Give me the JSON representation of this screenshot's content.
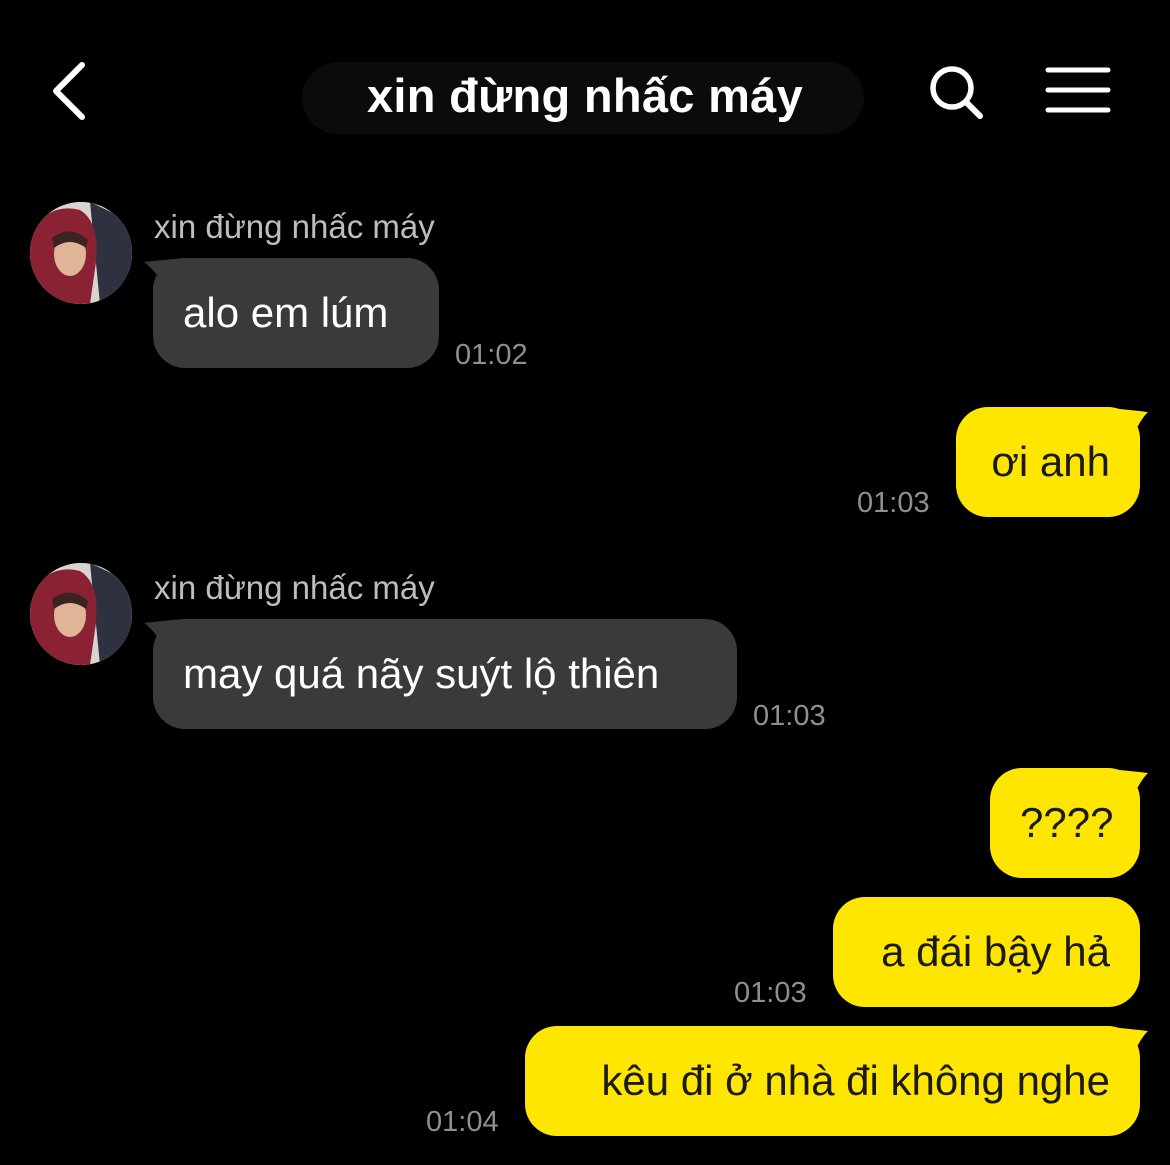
{
  "header": {
    "title": "xin đừng nhấc máy",
    "back_icon": "chevron-left-icon",
    "search_icon": "search-icon",
    "menu_icon": "hamburger-menu-icon"
  },
  "colors": {
    "background": "#000000",
    "incoming_bubble": "#3a3a3c",
    "outgoing_bubble": "#ffe600",
    "timestamp": "#8e8e93"
  },
  "messages": [
    {
      "direction": "incoming",
      "sender": "xin đừng nhấc máy",
      "text": "alo em lúm",
      "time": "01:02"
    },
    {
      "direction": "outgoing",
      "text": "ơi anh",
      "time": "01:03"
    },
    {
      "direction": "incoming",
      "sender": "xin đừng nhấc máy",
      "text": "may quá nãy suýt lộ thiên",
      "time": "01:03"
    },
    {
      "direction": "outgoing",
      "text": "????",
      "time": ""
    },
    {
      "direction": "outgoing",
      "text": "a đái bậy hả",
      "time": "01:03"
    },
    {
      "direction": "outgoing",
      "text": "kêu đi ở nhà đi không nghe",
      "time": "01:04"
    }
  ]
}
